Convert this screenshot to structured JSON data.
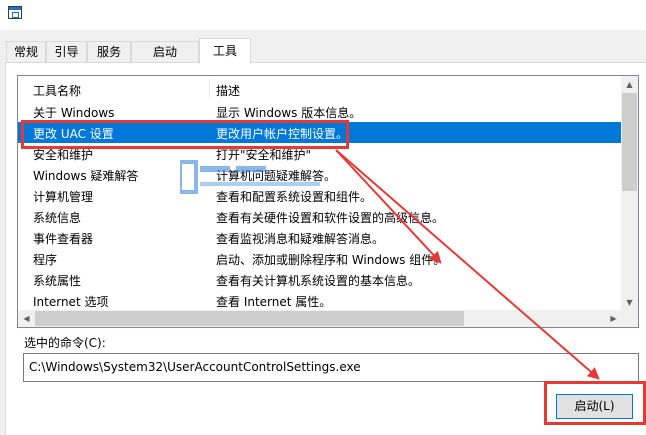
{
  "window": {
    "icon": "msconfig-window-icon"
  },
  "tabs": [
    "常规",
    "引导",
    "服务",
    "启动",
    "工具"
  ],
  "active_tab_index": 4,
  "list": {
    "columns": [
      "工具名称",
      "描述"
    ],
    "rows": [
      {
        "name": "关于 Windows",
        "desc": "显示 Windows 版本信息。"
      },
      {
        "name": "更改 UAC 设置",
        "desc": "更改用户帐户控制设置。"
      },
      {
        "name": "安全和维护",
        "desc": "打开\"安全和维护\""
      },
      {
        "name": "Windows 疑难解答",
        "desc": "计算机问题疑难解答。"
      },
      {
        "name": "计算机管理",
        "desc": "查看和配置系统设置和组件。"
      },
      {
        "name": "系统信息",
        "desc": "查看有关硬件设置和软件设置的高级信息。"
      },
      {
        "name": "事件查看器",
        "desc": "查看监视消息和疑难解答消息。"
      },
      {
        "name": "程序",
        "desc": "启动、添加或删除程序和 Windows 组件。"
      },
      {
        "name": "系统属性",
        "desc": "查看有关计算机系统设置的基本信息。"
      },
      {
        "name": "Internet 选项",
        "desc": "查看 Internet 属性。"
      }
    ],
    "selected_index": 1,
    "vertical_scroll_percent": 0,
    "horizontal_scroll_percent": 0
  },
  "command": {
    "label": "选中的命令(C):",
    "value": "C:\\Windows\\System32\\UserAccountControlSettings.exe"
  },
  "launch_button": "启动(L)",
  "colors": {
    "selection": "#0078d7",
    "annotation": "#e53935",
    "window_bg": "#f0f0f0"
  }
}
